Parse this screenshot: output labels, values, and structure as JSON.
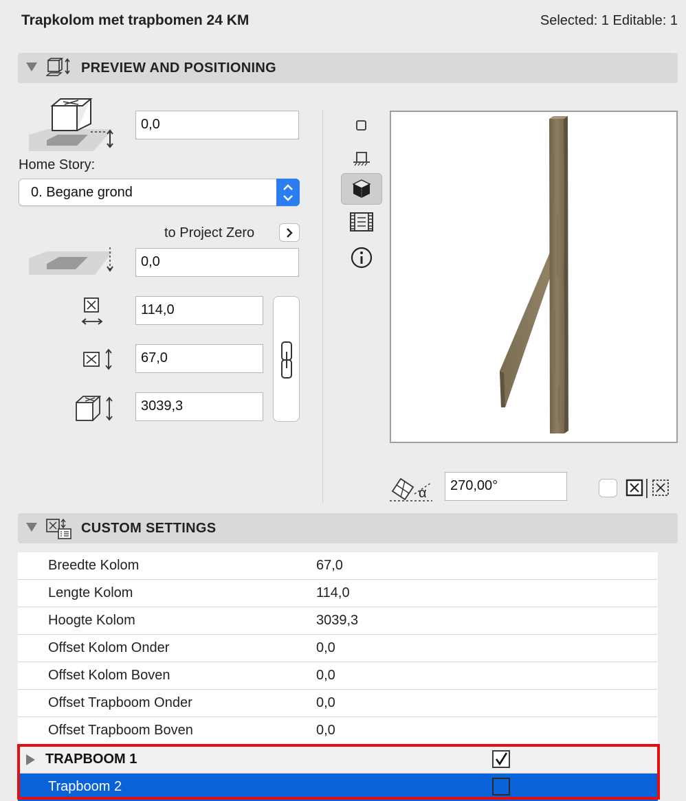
{
  "header": {
    "title": "Trapkolom met trapbomen 24 KM",
    "selection_info": "Selected: 1 Editable: 1"
  },
  "preview_section": {
    "title": "PREVIEW AND POSITIONING",
    "elevation_value": "0,0",
    "home_story_label": "Home Story:",
    "home_story_value": "0. Begane grond",
    "to_project_zero_label": "to Project Zero",
    "project_zero_value": "0,0",
    "width_value": "114,0",
    "depth_value": "67,0",
    "height_value": "3039,3",
    "rotation_value": "270,00°",
    "alpha_symbol": "α"
  },
  "custom_section": {
    "title": "CUSTOM SETTINGS",
    "rows": [
      {
        "name": "Breedte Kolom",
        "value": "67,0"
      },
      {
        "name": "Lengte Kolom",
        "value": "114,0"
      },
      {
        "name": "Hoogte Kolom",
        "value": "3039,3"
      },
      {
        "name": "Offset Kolom Onder",
        "value": "0,0"
      },
      {
        "name": "Offset Kolom Boven",
        "value": "0,0"
      },
      {
        "name": "Offset Trapboom Onder",
        "value": "0,0"
      },
      {
        "name": "Offset Trapboom Boven",
        "value": "0,0"
      }
    ],
    "group_row": {
      "name": "TRAPBOOM 1",
      "checked": true
    },
    "selected_row": {
      "name": "Trapboom 2",
      "checked": false
    }
  },
  "colors": {
    "accent": "#2b7df0",
    "selection": "#0a62d8",
    "highlight_border": "#e41010",
    "wood": "#8a7a5c"
  }
}
